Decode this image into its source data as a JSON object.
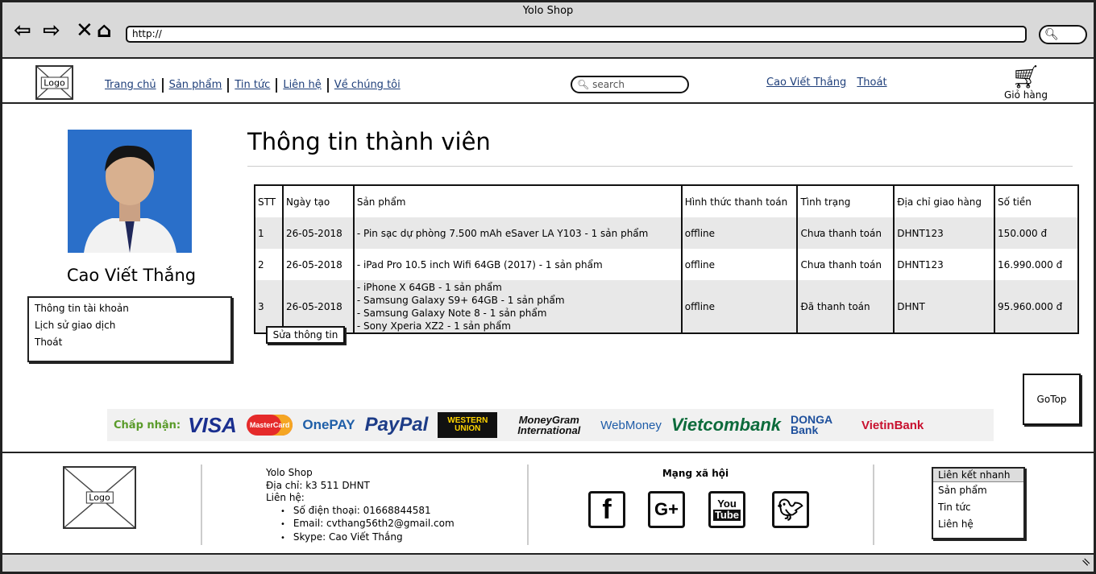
{
  "window": {
    "title": "Yolo Shop"
  },
  "browser": {
    "url": "http://",
    "icons": [
      "back-icon",
      "forward-icon",
      "close-icon",
      "home-icon",
      "search-icon"
    ]
  },
  "header": {
    "logo_label": "Logo",
    "nav": [
      "Trang chủ",
      "Sản phẩm",
      "Tin tức",
      "Liên hệ",
      "Về chúng tôi"
    ],
    "search_placeholder": "search",
    "user_name": "Cao Viết Thắng",
    "logout": "Thoát",
    "cart_label": "Giỏ hàng"
  },
  "profile": {
    "name": "Cao Viết Thắng",
    "menu": [
      "Thông tin tài khoản",
      "Lịch sử giao dịch",
      "Thoát"
    ]
  },
  "main": {
    "title": "Thông tin thành viên",
    "columns": [
      "STT",
      "Ngày tạo",
      "Sản phẩm",
      "Hình thức thanh toán",
      "Tình trạng",
      "Địa chỉ giao hàng",
      "Số tiền"
    ],
    "rows": [
      {
        "stt": "1",
        "date": "26-05-2018",
        "products": [
          "- Pin sạc dự phòng 7.500 mAh eSaver LA Y103 - 1 sản phẩm"
        ],
        "payment": "offline",
        "status": "Chưa thanh toán",
        "address": "DHNT123",
        "amount": "150.000 đ"
      },
      {
        "stt": "2",
        "date": "26-05-2018",
        "products": [
          "- iPad Pro 10.5 inch Wifi 64GB (2017) - 1 sản phẩm"
        ],
        "payment": "offline",
        "status": "Chưa thanh toán",
        "address": "DHNT123",
        "amount": "16.990.000 đ"
      },
      {
        "stt": "3",
        "date": "26-05-2018",
        "products": [
          "- iPhone X 64GB - 1 sản phẩm",
          "- Samsung Galaxy S9+ 64GB - 1 sản phẩm",
          "- Samsung Galaxy Note 8 - 1 sản phẩm",
          "- Sony Xperia XZ2 - 1 sản phẩm"
        ],
        "payment": "offline",
        "status": "Đã thanh toán",
        "address": "DHNT",
        "amount": "95.960.000 đ"
      }
    ],
    "edit_button": "Sửa thông tin",
    "gotop": "GoTop"
  },
  "payments": {
    "label": "Chấp nhận:",
    "logos": [
      "VISA",
      "MasterCard",
      "OnePAY",
      "PayPal",
      "WESTERN UNION",
      "MoneyGram International",
      "WebMoney",
      "Vietcombank",
      "DONGA Bank",
      "VietinBank"
    ]
  },
  "footer": {
    "logo_label": "Logo",
    "shop": "Yolo Shop",
    "address": "Địa chỉ: k3 511 DHNT",
    "contact_label": "Liên hệ:",
    "contacts": [
      "Số điện thoại: 01668844581",
      "Email: cvthang56th2@gmail.com",
      "Skype: Cao Viết Thắng"
    ],
    "social_title": "Mạng xã hội",
    "social": [
      "facebook-icon",
      "google-plus-icon",
      "youtube-icon",
      "twitter-icon"
    ],
    "quick_title": "Liên kết nhanh",
    "quick_links": [
      "Sản phẩm",
      "Tin tức",
      "Liên hệ"
    ]
  },
  "colors": {
    "link": "#1f3f7a",
    "accept_label": "#5a9b2a",
    "row_stripe": "#e8e8e8",
    "chrome": "#d9d9d9"
  }
}
